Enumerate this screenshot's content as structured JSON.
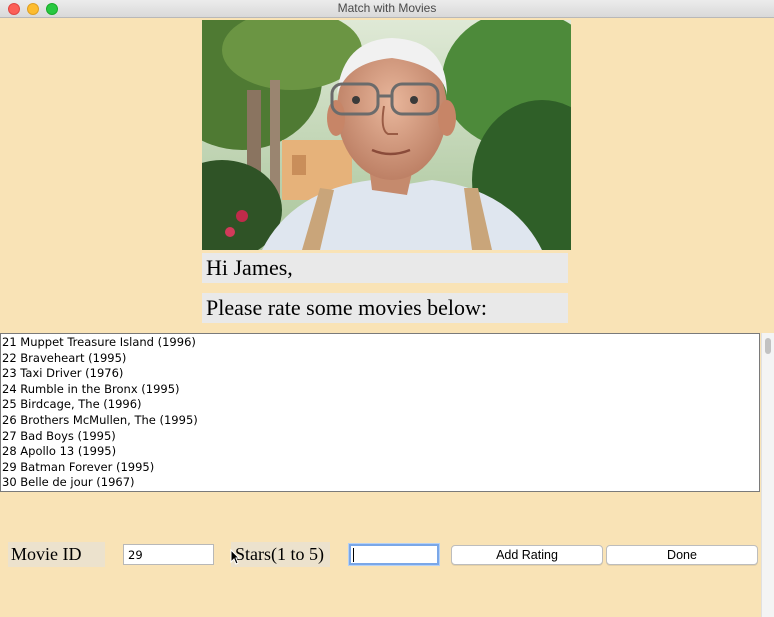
{
  "window": {
    "title": "Match with Movies"
  },
  "profile": {
    "photo_icon": "elderly-man-portrait",
    "greeting": "Hi James,",
    "prompt": "Please rate some movies below:"
  },
  "movies": [
    "21 Muppet Treasure Island (1996)",
    "22 Braveheart (1995)",
    "23 Taxi Driver (1976)",
    "24 Rumble in the Bronx (1995)",
    "25 Birdcage, The (1996)",
    "26 Brothers McMullen, The (1995)",
    "27 Bad Boys (1995)",
    "28 Apollo 13 (1995)",
    "29 Batman Forever (1995)",
    "30 Belle de jour (1967)"
  ],
  "rating_form": {
    "movie_id_label": "Movie ID",
    "movie_id_value": "29",
    "stars_label": "Stars(1 to 5)",
    "stars_value": "",
    "add_button_label": "Add Rating",
    "done_button_label": "Done"
  },
  "colors": {
    "background": "#f9e3b6",
    "label_background": "#e9e9e9",
    "focus_ring": "#7aa7e8"
  }
}
